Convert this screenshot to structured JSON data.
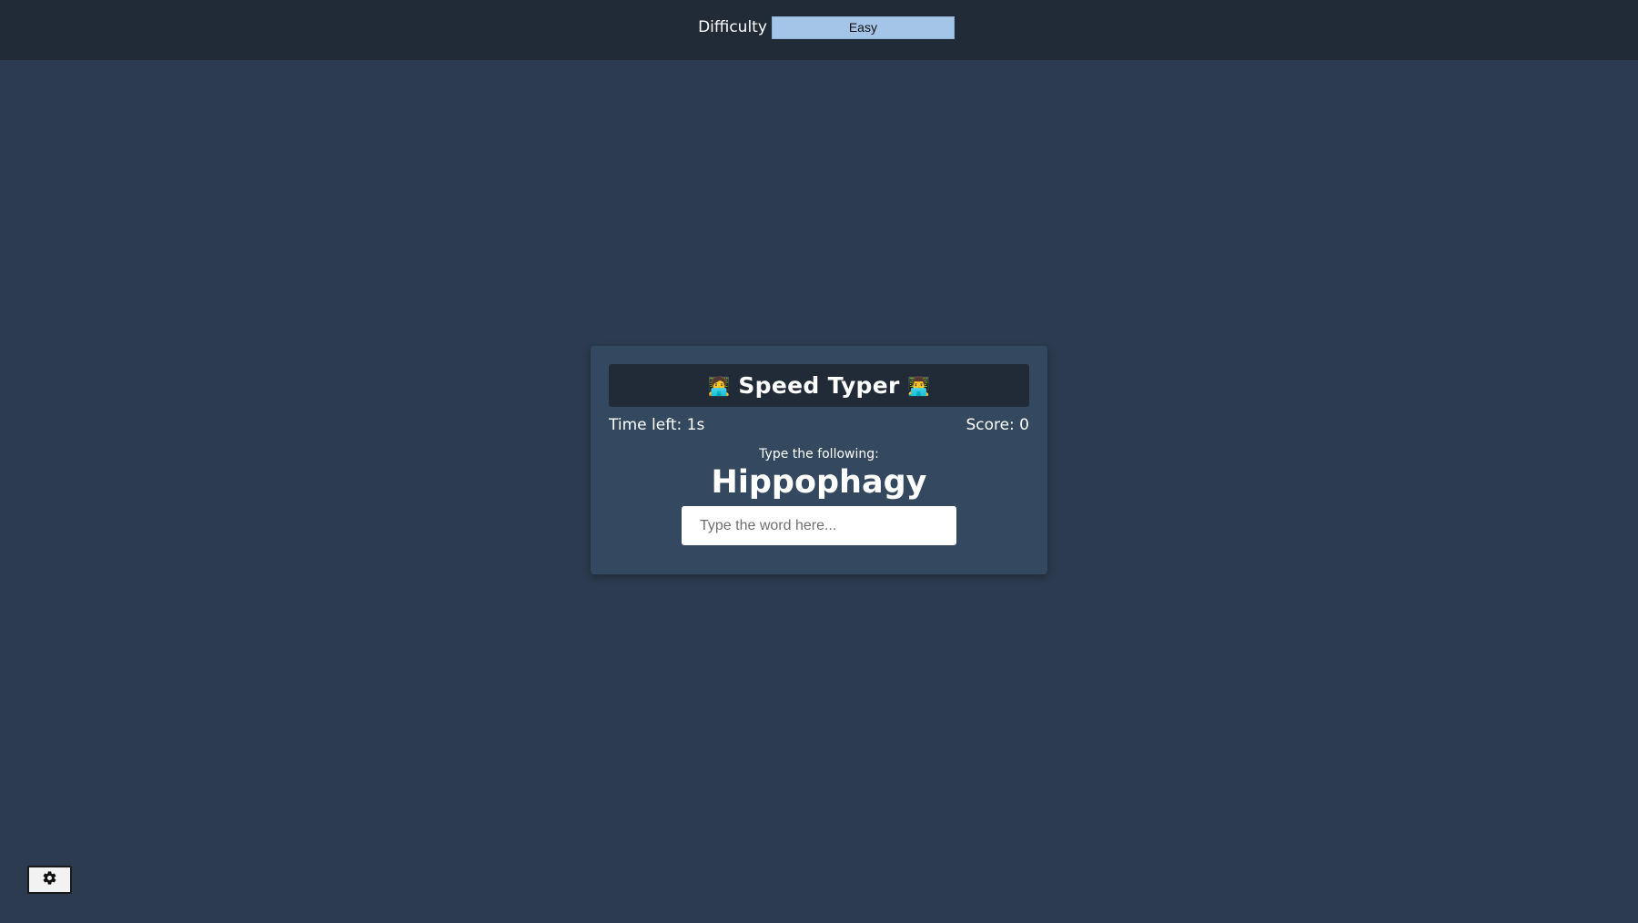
{
  "header": {
    "difficulty_label": "Difficulty",
    "difficulty_selected": "Easy"
  },
  "game": {
    "title": "Speed Typer",
    "title_emoji_left": "🧑‍💻",
    "title_emoji_right": "👨‍💻",
    "time_left": "Time left: 1s",
    "score": "Score: 0",
    "prompt": "Type the following:",
    "word": "Hippophagy",
    "input_placeholder": "Type the word here...",
    "input_value": ""
  },
  "settings": {
    "icon": "gear-icon"
  },
  "colors": {
    "background": "#2c3b4f",
    "header": "#212b38",
    "card": "#34485f",
    "select": "#a4c4e8"
  }
}
